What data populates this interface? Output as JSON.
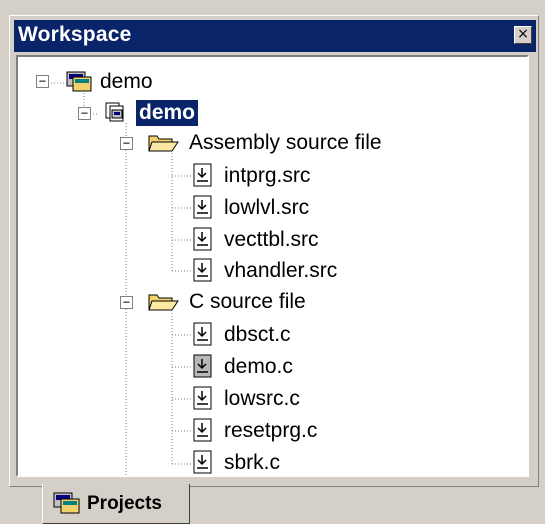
{
  "window": {
    "title": "Workspace",
    "close_glyph": "×"
  },
  "tree": {
    "workspace_root": "demo",
    "project": "demo",
    "folders": [
      {
        "label": "Assembly source file",
        "files": [
          "intprg.src",
          "lowlvl.src",
          "vecttbl.src",
          "vhandler.src"
        ]
      },
      {
        "label": "C source file",
        "files": [
          "dbsct.c",
          "demo.c",
          "lowsrc.c",
          "resetprg.c",
          "sbrk.c"
        ]
      }
    ]
  },
  "tabs": {
    "projects_label": "Projects"
  },
  "colors": {
    "titlebar": "#0a246a",
    "selection": "#0a246a",
    "folder": "#f2d06b"
  },
  "icons": {
    "workspace": "workspace-icon",
    "project": "project-icon",
    "folder": "folder-open-icon",
    "file": "source-file-icon"
  }
}
